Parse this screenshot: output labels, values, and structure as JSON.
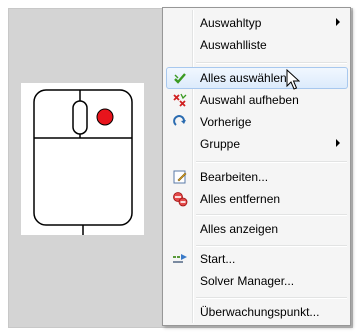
{
  "menu": {
    "items": [
      {
        "label": "Auswahltyp",
        "icon": "none",
        "submenu": true
      },
      {
        "label": "Auswahlliste",
        "icon": "none",
        "submenu": false
      },
      {
        "label": "Alles auswählen",
        "icon": "check-icon",
        "submenu": false,
        "highlighted": true
      },
      {
        "label": "Auswahl aufheben",
        "icon": "deselect-icon",
        "submenu": false
      },
      {
        "label": "Vorherige",
        "icon": "redo-arrow-icon",
        "submenu": false
      },
      {
        "label": "Gruppe",
        "icon": "none",
        "submenu": true
      },
      {
        "label": "Bearbeiten...",
        "icon": "edit-icon",
        "submenu": false
      },
      {
        "label": "Alles entfernen",
        "icon": "remove-icon",
        "submenu": false
      },
      {
        "label": "Alles anzeigen",
        "icon": "none",
        "submenu": false
      },
      {
        "label": "Start...",
        "icon": "start-icon",
        "submenu": false
      },
      {
        "label": "Solver Manager...",
        "icon": "none",
        "submenu": false
      },
      {
        "label": "Überwachungspunkt...",
        "icon": "none",
        "submenu": false
      }
    ]
  },
  "colors": {
    "highlight_border": "#a8c8ee",
    "mouse_button": "#e8141c",
    "check": "#3a9a22",
    "remove": "#d02020"
  }
}
